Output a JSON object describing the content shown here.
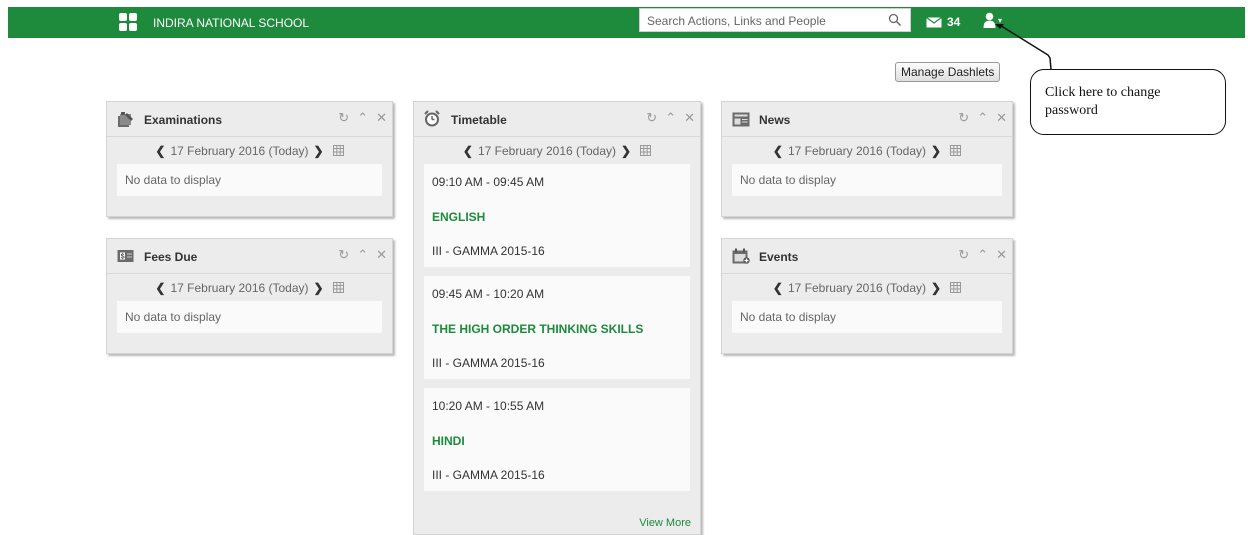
{
  "header": {
    "school_name": "INDIRA NATIONAL SCHOOL",
    "search_placeholder": "Search Actions, Links and People",
    "mail_count": "34",
    "bg_color": "#1e8a3c"
  },
  "toolbar": {
    "manage_label": "Manage Dashlets"
  },
  "dashlets": {
    "examinations": {
      "title": "Examinations",
      "date": "17 February 2016 (Today)",
      "empty": "No data to display"
    },
    "fees": {
      "title": "Fees Due",
      "date": "17 February 2016 (Today)",
      "empty": "No data to display"
    },
    "timetable": {
      "title": "Timetable",
      "date": "17 February 2016 (Today)",
      "slots": [
        {
          "time": "09:10 AM - 09:45 AM",
          "subject": "ENGLISH",
          "class": "III - GAMMA 2015-16"
        },
        {
          "time": "09:45 AM - 10:20 AM",
          "subject": "THE HIGH ORDER THINKING SKILLS",
          "class": "III - GAMMA 2015-16"
        },
        {
          "time": "10:20 AM - 10:55 AM",
          "subject": "HINDI",
          "class": "III - GAMMA 2015-16"
        }
      ],
      "view_more": "View More"
    },
    "news": {
      "title": "News",
      "date": "17 February 2016 (Today)",
      "empty": "No data to display"
    },
    "events": {
      "title": "Events",
      "date": "17 February 2016 (Today)",
      "empty": "No data to display"
    }
  },
  "controls": {
    "refresh": "↻",
    "collapse": "⌃",
    "close": "✕",
    "prev": "❮",
    "next": "❯"
  },
  "icons": [
    "apps-grid-icon",
    "search-icon",
    "mail-icon",
    "user-icon",
    "chevron-down-icon",
    "exam-icon",
    "alarm-clock-icon",
    "news-icon",
    "fees-icon",
    "events-icon",
    "calendar-icon"
  ],
  "annotation": {
    "text": "Click here to change password"
  }
}
